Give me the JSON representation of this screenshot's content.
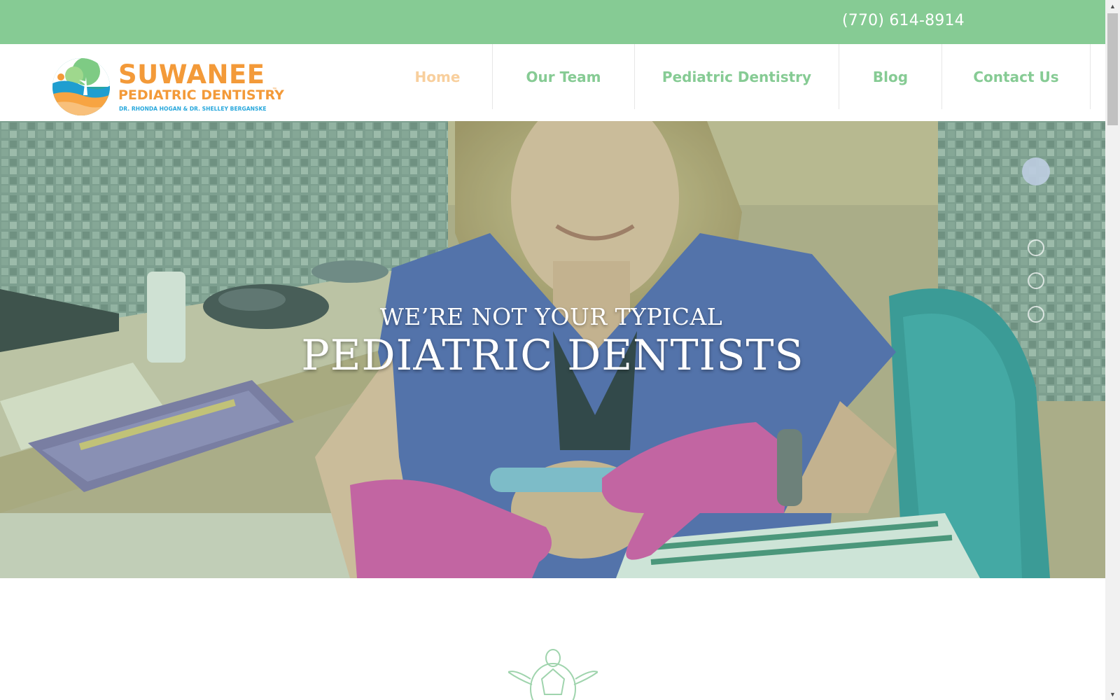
{
  "topbar": {
    "phone": "(770) 614-8914"
  },
  "logo": {
    "title": "SUWANEE",
    "subtitle": "PEDIATRIC DENTISTRY",
    "tm": "™",
    "doctors": "DR. RHONDA HOGAN & DR. SHELLEY BERGANSKE"
  },
  "nav": {
    "items": [
      {
        "label": "Home",
        "active": true
      },
      {
        "label": "Our Team",
        "active": false
      },
      {
        "label": "Pediatric Dentistry",
        "active": false
      },
      {
        "label": "Blog",
        "active": false
      },
      {
        "label": "Contact Us",
        "active": false
      }
    ]
  },
  "hero": {
    "line1": "WE’RE NOT YOUR TYPICAL",
    "line2": "PEDIATRIC DENTISTS",
    "slides_total": 4,
    "active_slide": 1
  },
  "colors": {
    "brand_green": "#86cb94",
    "brand_orange": "#f39a39",
    "brand_blue": "#29a8dc",
    "nav_active": "#f8cf9d"
  }
}
